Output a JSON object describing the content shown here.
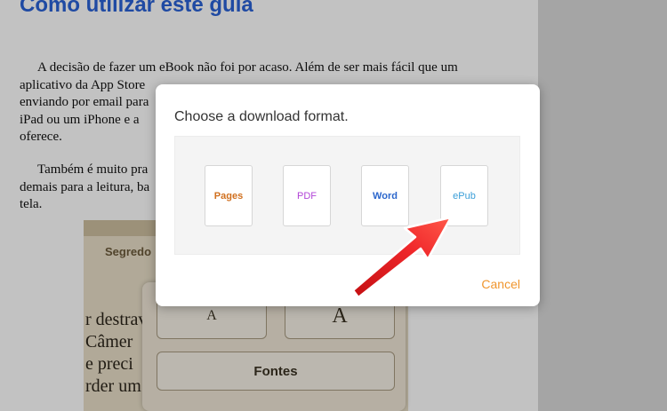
{
  "document": {
    "heading": "Como utilizar este guia",
    "para1_lines": [
      "A decisão de fazer um eBook não foi por acaso. Além de ser mais fácil que um",
      "aplicativo da App Store",
      "enviando por email para",
      "iPad ou um iPhone e a",
      "oferece."
    ],
    "para2_lines": [
      "Também é muito pra",
      "demais para a leitura, ba",
      "tela."
    ]
  },
  "ebook_screenshot": {
    "title": "Segredo",
    "text_lines": [
      "r destrav",
      "Câmer",
      "e preci",
      "rder um"
    ],
    "font_panel": {
      "small_a": "A",
      "large_a": "A",
      "fonts_label": "Fontes"
    }
  },
  "dialog": {
    "title": "Choose a download format.",
    "formats": [
      "Pages",
      "PDF",
      "Word",
      "ePub"
    ],
    "cancel_label": "Cancel",
    "format_colors": {
      "pages": "#d0701f",
      "pdf": "#b244d8",
      "word": "#2b66cc",
      "epub": "#3a9ed8"
    },
    "cancel_color": "#f0962e"
  },
  "annotation": {
    "arrow_color": "#e8191c",
    "arrow_icon": "red-arrow-icon"
  }
}
